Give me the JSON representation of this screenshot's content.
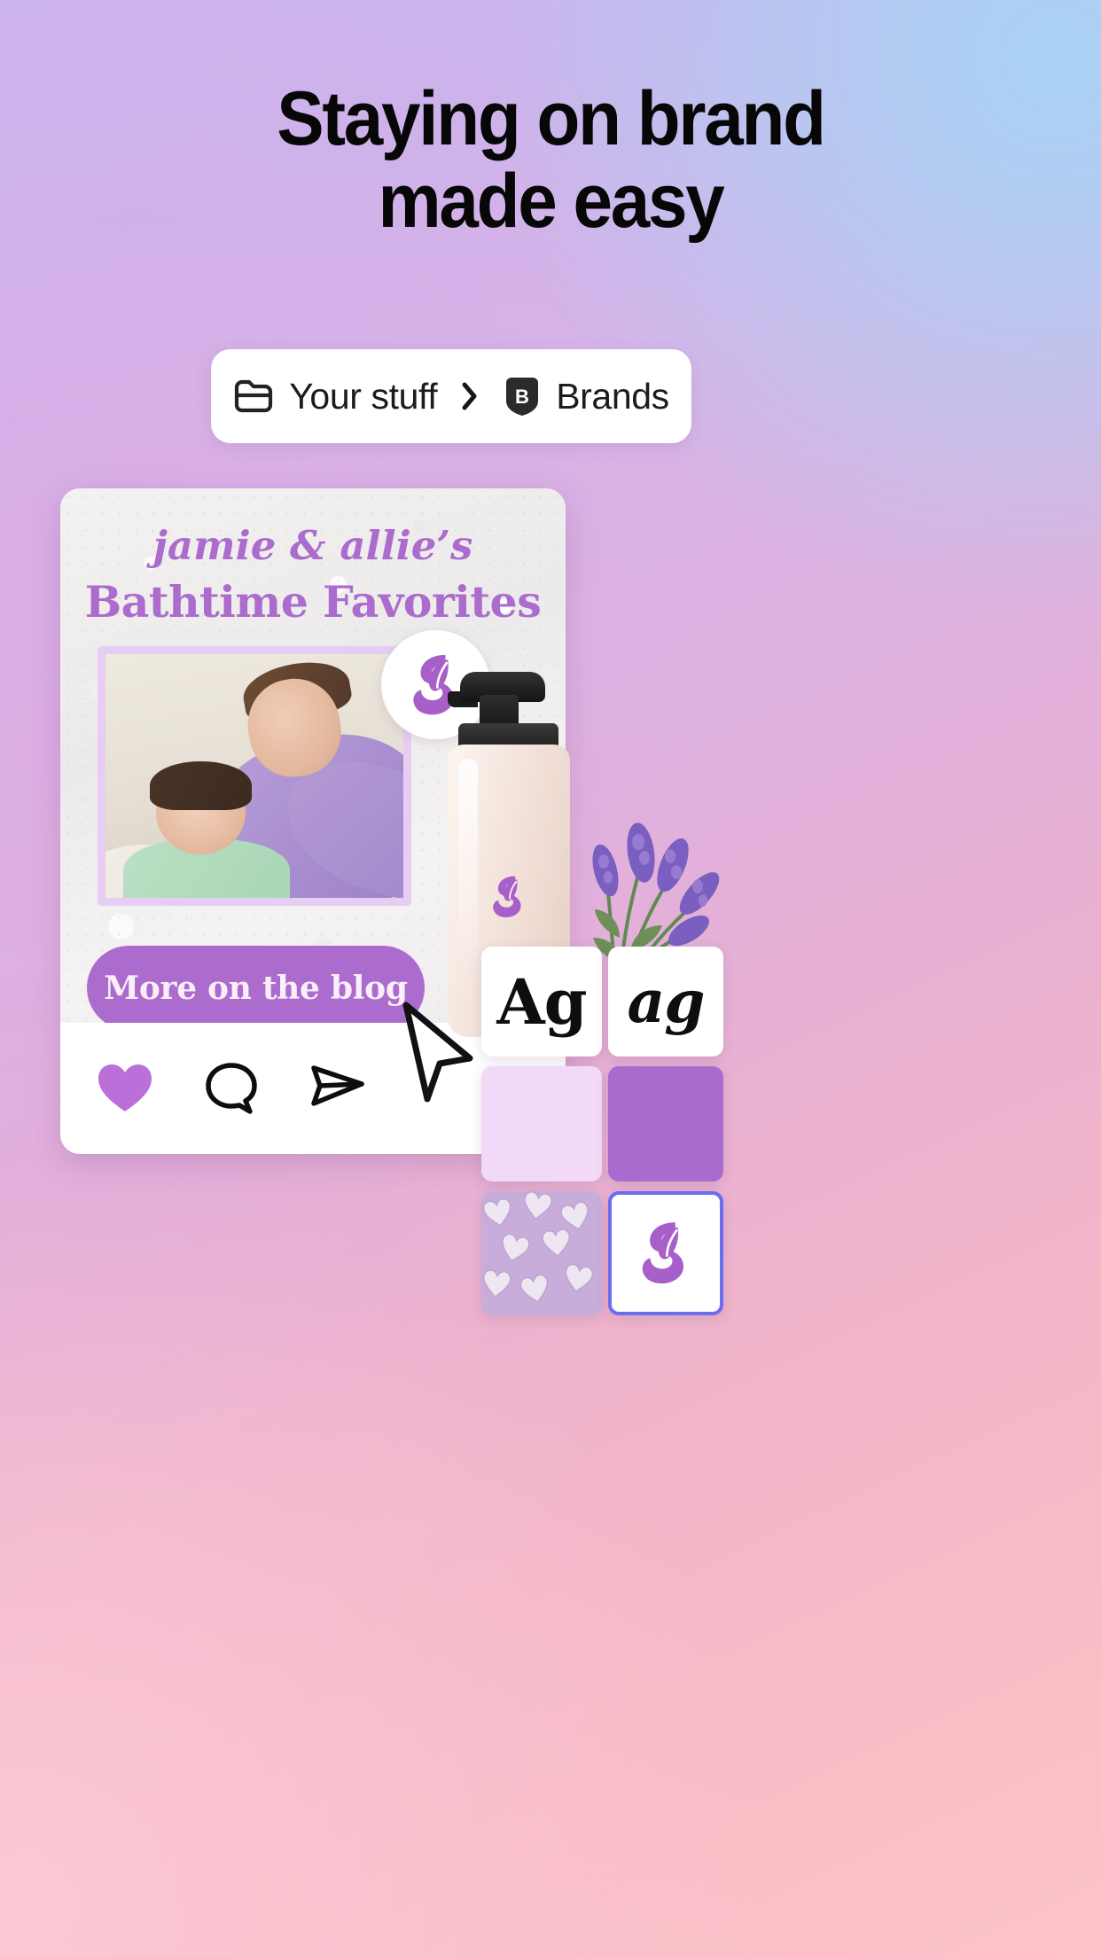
{
  "headline": {
    "line1": "Staying on brand",
    "line2": "made easy"
  },
  "breadcrumb": {
    "folder_icon": "folder-icon",
    "first_label": "Your stuff",
    "separator_icon": "chevron-right-icon",
    "brand_badge_letter": "B",
    "brand_badge_icon": "brand-kit-badge-icon",
    "second_label": "Brands"
  },
  "post_card": {
    "title_line1": "jamie & allie’s",
    "title_line2": "Bathtime Favorites",
    "logo_icon": "leaf-s-logo-icon",
    "cta_label": "More on the blog",
    "actions": [
      {
        "name": "like-button",
        "icon": "heart-filled-icon"
      },
      {
        "name": "comment-button",
        "icon": "comment-bubble-icon"
      },
      {
        "name": "share-button",
        "icon": "paper-plane-icon"
      }
    ]
  },
  "product": {
    "bottle_icon": "lotion-pump-bottle",
    "bottle_mark_icon": "leaf-s-logo-icon",
    "sprig_icon": "lavender-sprigs"
  },
  "brand_kit": {
    "font_tiles": [
      {
        "name": "font-tile-uppercase",
        "sample": "Ag"
      },
      {
        "name": "font-tile-lowercase",
        "sample": "ag"
      }
    ],
    "swatches": [
      {
        "name": "color-swatch-light-lilac",
        "hex": "#F2D9F7"
      },
      {
        "name": "color-swatch-purple",
        "hex": "#A86BCE"
      }
    ],
    "pattern_tile": {
      "name": "pattern-tile-hearts",
      "icon": "hearts-pattern"
    },
    "logo_tile": {
      "name": "logo-tile",
      "icon": "leaf-s-logo-icon",
      "selected": true
    }
  },
  "cursor": {
    "icon": "arrow-cursor"
  },
  "colors": {
    "brand_purple": "#AB6CCD",
    "light_lilac": "#F2D9F7",
    "deep_purple": "#A86BCE",
    "selection_blue": "#6A6DF0",
    "headline_text": "#070708"
  }
}
